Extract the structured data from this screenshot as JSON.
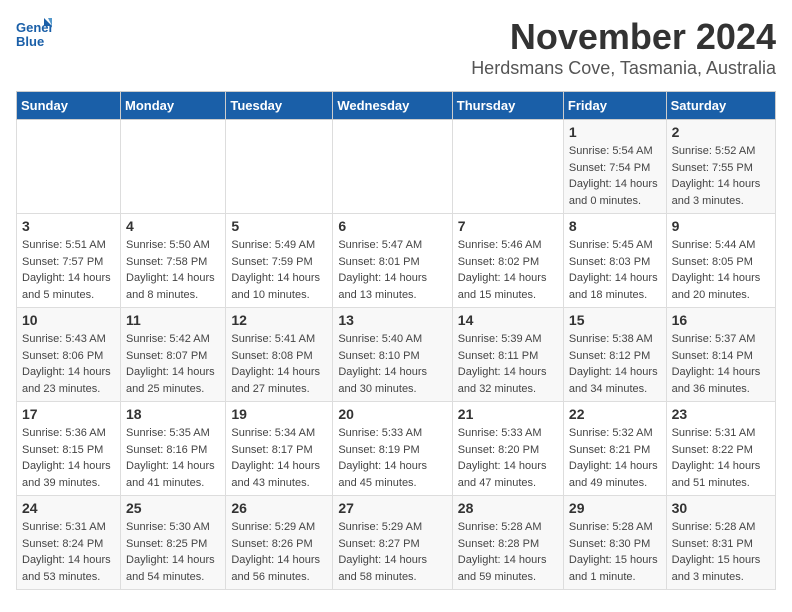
{
  "logo": {
    "line1": "General",
    "line2": "Blue"
  },
  "title": "November 2024",
  "subtitle": "Herdsmans Cove, Tasmania, Australia",
  "days_of_week": [
    "Sunday",
    "Monday",
    "Tuesday",
    "Wednesday",
    "Thursday",
    "Friday",
    "Saturday"
  ],
  "weeks": [
    [
      {
        "day": "",
        "info": ""
      },
      {
        "day": "",
        "info": ""
      },
      {
        "day": "",
        "info": ""
      },
      {
        "day": "",
        "info": ""
      },
      {
        "day": "",
        "info": ""
      },
      {
        "day": "1",
        "info": "Sunrise: 5:54 AM\nSunset: 7:54 PM\nDaylight: 14 hours and 0 minutes."
      },
      {
        "day": "2",
        "info": "Sunrise: 5:52 AM\nSunset: 7:55 PM\nDaylight: 14 hours and 3 minutes."
      }
    ],
    [
      {
        "day": "3",
        "info": "Sunrise: 5:51 AM\nSunset: 7:57 PM\nDaylight: 14 hours and 5 minutes."
      },
      {
        "day": "4",
        "info": "Sunrise: 5:50 AM\nSunset: 7:58 PM\nDaylight: 14 hours and 8 minutes."
      },
      {
        "day": "5",
        "info": "Sunrise: 5:49 AM\nSunset: 7:59 PM\nDaylight: 14 hours and 10 minutes."
      },
      {
        "day": "6",
        "info": "Sunrise: 5:47 AM\nSunset: 8:01 PM\nDaylight: 14 hours and 13 minutes."
      },
      {
        "day": "7",
        "info": "Sunrise: 5:46 AM\nSunset: 8:02 PM\nDaylight: 14 hours and 15 minutes."
      },
      {
        "day": "8",
        "info": "Sunrise: 5:45 AM\nSunset: 8:03 PM\nDaylight: 14 hours and 18 minutes."
      },
      {
        "day": "9",
        "info": "Sunrise: 5:44 AM\nSunset: 8:05 PM\nDaylight: 14 hours and 20 minutes."
      }
    ],
    [
      {
        "day": "10",
        "info": "Sunrise: 5:43 AM\nSunset: 8:06 PM\nDaylight: 14 hours and 23 minutes."
      },
      {
        "day": "11",
        "info": "Sunrise: 5:42 AM\nSunset: 8:07 PM\nDaylight: 14 hours and 25 minutes."
      },
      {
        "day": "12",
        "info": "Sunrise: 5:41 AM\nSunset: 8:08 PM\nDaylight: 14 hours and 27 minutes."
      },
      {
        "day": "13",
        "info": "Sunrise: 5:40 AM\nSunset: 8:10 PM\nDaylight: 14 hours and 30 minutes."
      },
      {
        "day": "14",
        "info": "Sunrise: 5:39 AM\nSunset: 8:11 PM\nDaylight: 14 hours and 32 minutes."
      },
      {
        "day": "15",
        "info": "Sunrise: 5:38 AM\nSunset: 8:12 PM\nDaylight: 14 hours and 34 minutes."
      },
      {
        "day": "16",
        "info": "Sunrise: 5:37 AM\nSunset: 8:14 PM\nDaylight: 14 hours and 36 minutes."
      }
    ],
    [
      {
        "day": "17",
        "info": "Sunrise: 5:36 AM\nSunset: 8:15 PM\nDaylight: 14 hours and 39 minutes."
      },
      {
        "day": "18",
        "info": "Sunrise: 5:35 AM\nSunset: 8:16 PM\nDaylight: 14 hours and 41 minutes."
      },
      {
        "day": "19",
        "info": "Sunrise: 5:34 AM\nSunset: 8:17 PM\nDaylight: 14 hours and 43 minutes."
      },
      {
        "day": "20",
        "info": "Sunrise: 5:33 AM\nSunset: 8:19 PM\nDaylight: 14 hours and 45 minutes."
      },
      {
        "day": "21",
        "info": "Sunrise: 5:33 AM\nSunset: 8:20 PM\nDaylight: 14 hours and 47 minutes."
      },
      {
        "day": "22",
        "info": "Sunrise: 5:32 AM\nSunset: 8:21 PM\nDaylight: 14 hours and 49 minutes."
      },
      {
        "day": "23",
        "info": "Sunrise: 5:31 AM\nSunset: 8:22 PM\nDaylight: 14 hours and 51 minutes."
      }
    ],
    [
      {
        "day": "24",
        "info": "Sunrise: 5:31 AM\nSunset: 8:24 PM\nDaylight: 14 hours and 53 minutes."
      },
      {
        "day": "25",
        "info": "Sunrise: 5:30 AM\nSunset: 8:25 PM\nDaylight: 14 hours and 54 minutes."
      },
      {
        "day": "26",
        "info": "Sunrise: 5:29 AM\nSunset: 8:26 PM\nDaylight: 14 hours and 56 minutes."
      },
      {
        "day": "27",
        "info": "Sunrise: 5:29 AM\nSunset: 8:27 PM\nDaylight: 14 hours and 58 minutes."
      },
      {
        "day": "28",
        "info": "Sunrise: 5:28 AM\nSunset: 8:28 PM\nDaylight: 14 hours and 59 minutes."
      },
      {
        "day": "29",
        "info": "Sunrise: 5:28 AM\nSunset: 8:30 PM\nDaylight: 15 hours and 1 minute."
      },
      {
        "day": "30",
        "info": "Sunrise: 5:28 AM\nSunset: 8:31 PM\nDaylight: 15 hours and 3 minutes."
      }
    ]
  ]
}
